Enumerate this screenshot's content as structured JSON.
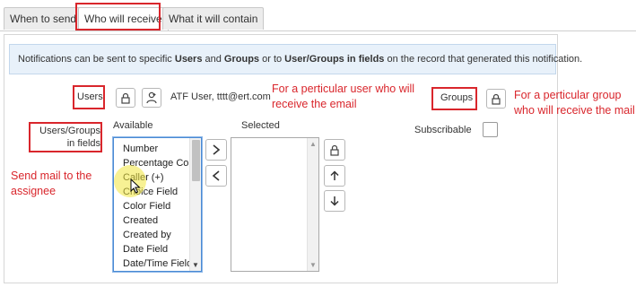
{
  "tabs": [
    {
      "label": "When to send"
    },
    {
      "label": "Who will receive"
    },
    {
      "label": "What it will contain"
    }
  ],
  "info": {
    "t1": "Notifications can be sent to specific ",
    "b1": "Users",
    "t2": " and ",
    "b2": "Groups",
    "t3": " or to ",
    "b3": "User/Groups in fields",
    "t4": " on the record that generated this notification."
  },
  "users": {
    "label": "Users",
    "value": "ATF User, tttt@ert.com"
  },
  "groups": {
    "label": "Groups"
  },
  "fields": {
    "label": "Users/Groups in fields",
    "available_label": "Available",
    "selected_label": "Selected",
    "available_options": [
      "Number",
      "Percentage Com",
      "Caller (+)",
      "Choice Field",
      "Color Field",
      "Created",
      "Created by",
      "Date Field",
      "Date/Time Field"
    ]
  },
  "subscribable": {
    "label": "Subscribable"
  },
  "annotations": {
    "user": "For a perticular user who will receive the email",
    "group": "For a perticular group who will receive the mail",
    "assignee": "Send mail to the assignee"
  },
  "colors": {
    "annotation": "#d9262c",
    "info_bg": "#e8f1fa",
    "focus": "#4a8ad4"
  }
}
